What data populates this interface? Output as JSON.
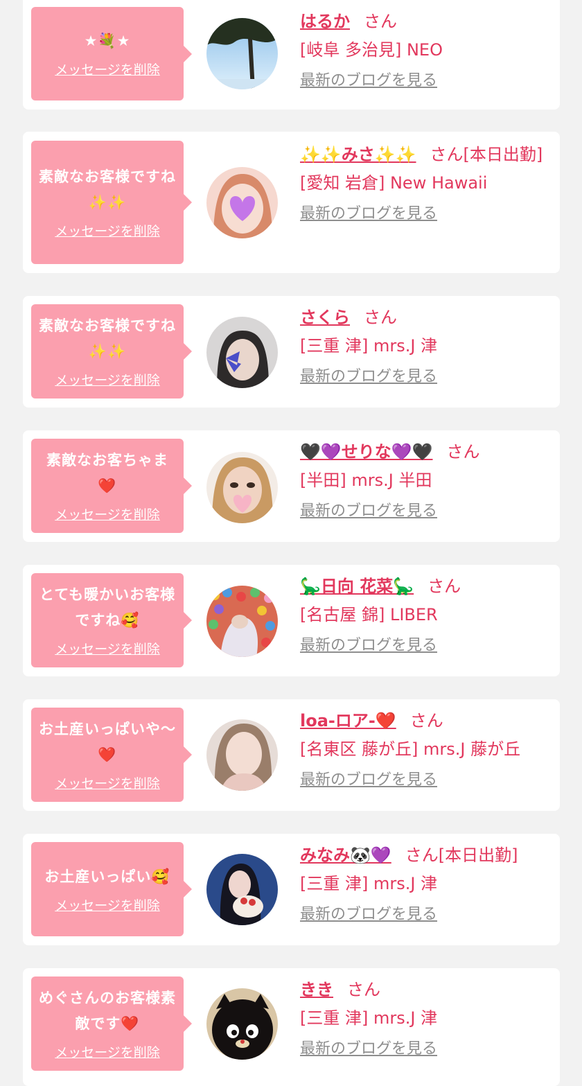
{
  "common": {
    "delete_label": "メッセージを削除",
    "blog_label": "最新のブログを見る",
    "san": "さん"
  },
  "cards": [
    {
      "message": "★💐★",
      "name": "はるか",
      "suffix": "さん",
      "shop": "[岐阜 多治見] NEO"
    },
    {
      "message": "素敵なお客様ですね✨✨",
      "name": "✨✨みさ✨✨",
      "suffix": "さん[本日出勤]",
      "shop": "[愛知 岩倉] New Hawaii"
    },
    {
      "message": "素敵なお客様ですね✨✨",
      "name": "さくら",
      "suffix": "さん",
      "shop": "[三重 津] mrs.J 津"
    },
    {
      "message": "素敵なお客ちゃま❤️",
      "name": "🖤💜せりな💜🖤",
      "suffix": "さん",
      "shop": "[半田] mrs.J 半田"
    },
    {
      "message": "とても暖かいお客様ですね🥰",
      "name": "🦕日向 花菜🦕",
      "suffix": "さん",
      "shop": "[名古屋 錦] LIBER"
    },
    {
      "message": "お土産いっぱいや〜❤️",
      "name": "loa-ロア-❤️",
      "suffix": "さん",
      "shop": "[名東区 藤が丘] mrs.J 藤が丘"
    },
    {
      "message": "お土産いっぱい🥰",
      "name": "みなみ🐼💜",
      "suffix": "さん[本日出勤]",
      "shop": "[三重 津] mrs.J 津"
    },
    {
      "message": "めぐさんのお客様素敵です❤️",
      "name": "きき",
      "suffix": "さん",
      "shop": "[三重 津] mrs.J 津"
    }
  ],
  "colors": {
    "background": "#f2f2f2",
    "bubble": "#fb9fae",
    "name_text": "#e2385d",
    "link_gray": "#8e8e8e"
  }
}
